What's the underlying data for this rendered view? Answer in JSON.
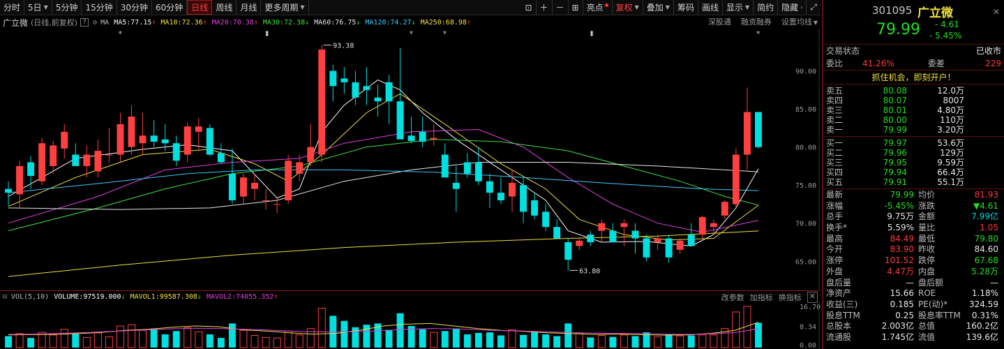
{
  "toolbar": {
    "periods": [
      "分时",
      "5日",
      "5分钟",
      "15分钟",
      "30分钟",
      "60分钟",
      "日线",
      "周线",
      "月线",
      "更多周期"
    ],
    "active_period": "日线",
    "tools": [
      "亮点",
      "复权",
      "叠加",
      "筹码",
      "画线",
      "显示",
      "简约",
      "隐藏"
    ],
    "icons": [
      "lock-icon",
      "plus-icon",
      "minus-icon",
      "grid-icon"
    ]
  },
  "stock": {
    "name": "广立微",
    "sub": "(日线,前复权)",
    "code": "301095",
    "price": "79.99",
    "change": "- 4.61",
    "change_pct": "- 5.45%"
  },
  "ma_legend": {
    "label": "MA",
    "items": [
      {
        "text": "MA5:77.15",
        "arrow": "↑",
        "color": "#ffffff"
      },
      {
        "text": "MA10:72.36",
        "arrow": "↑",
        "color": "#f0e040"
      },
      {
        "text": "MA20:70.38",
        "arrow": "↑",
        "color": "#e040e0"
      },
      {
        "text": "MA30:72.38",
        "arrow": "↓",
        "color": "#40e040"
      },
      {
        "text": "MA60:76.75",
        "arrow": "↓",
        "color": "#e8e8e8"
      },
      {
        "text": "MA120:74.27",
        "arrow": "↓",
        "color": "#40c8ff"
      },
      {
        "text": "MA250:68.98",
        "arrow": "↑",
        "color": "#f0e040"
      }
    ],
    "right": [
      "深股通",
      "融资融券",
      "设置均线"
    ]
  },
  "volume_legend": {
    "label": "VOL(5,10)",
    "items": [
      {
        "text": "VOLUME:97519.000",
        "arrow": "↓",
        "color": "#ffffff"
      },
      {
        "text": "MAVOL1:99587.308",
        "arrow": "↓",
        "color": "#f0e040"
      },
      {
        "text": "MAVOL2:74055.352",
        "arrow": "↑",
        "color": "#e040e0"
      }
    ],
    "right": [
      "改参数",
      "加指标",
      "换指标"
    ]
  },
  "chart_data": {
    "type": "candlestick",
    "ylim": [
      62,
      95
    ],
    "y_ticks": [
      65,
      70,
      75,
      80,
      85,
      90
    ],
    "y_tick_labels": [
      "65.00",
      "70.00",
      "75.00",
      "80.00",
      "85.00",
      "90.00"
    ],
    "max_label": "93.38",
    "min_label": "63.80",
    "candles": [
      [
        74.5,
        75.5,
        72.3,
        74.0
      ],
      [
        73.8,
        78.2,
        72.0,
        77.5
      ],
      [
        78.0,
        78.8,
        74.5,
        76.2
      ],
      [
        75.5,
        81.2,
        75.0,
        80.5
      ],
      [
        77.5,
        80.8,
        76.5,
        80.2
      ],
      [
        79.8,
        83.0,
        78.5,
        82.0
      ],
      [
        79.0,
        80.5,
        77.5,
        77.5
      ],
      [
        77.5,
        80.2,
        76.0,
        79.0
      ],
      [
        76.8,
        81.0,
        76.0,
        79.5
      ],
      [
        79.0,
        82.5,
        78.0,
        79.0
      ],
      [
        79.0,
        84.5,
        78.0,
        83.0
      ],
      [
        80.0,
        85.5,
        79.0,
        84.0
      ],
      [
        80.5,
        84.5,
        79.0,
        81.5
      ],
      [
        81.5,
        83.5,
        80.0,
        80.7
      ],
      [
        81.0,
        83.0,
        79.5,
        80.5
      ],
      [
        80.5,
        81.5,
        77.5,
        78.2
      ],
      [
        79.0,
        83.2,
        78.0,
        82.7
      ],
      [
        82.0,
        83.8,
        79.5,
        82.7
      ],
      [
        82.5,
        83.0,
        78.8,
        79.0
      ],
      [
        79.2,
        80.5,
        77.8,
        78.0
      ],
      [
        76.5,
        79.8,
        72.5,
        73.0
      ],
      [
        73.5,
        76.5,
        72.5,
        76.0
      ],
      [
        74.5,
        76.5,
        73.0,
        75.3
      ],
      [
        73.0,
        74.5,
        71.8,
        73.0
      ],
      [
        72.5,
        73.5,
        71.3,
        72.5
      ],
      [
        73.0,
        79.0,
        72.5,
        78.2
      ],
      [
        76.5,
        79.0,
        75.5,
        78.0
      ],
      [
        78.0,
        83.0,
        77.5,
        80.0
      ],
      [
        79.0,
        93.38,
        78.0,
        92.8
      ],
      [
        90.0,
        90.8,
        86.0,
        88.0
      ],
      [
        89.0,
        90.5,
        87.0,
        88.5
      ],
      [
        88.5,
        90.0,
        85.5,
        86.5
      ],
      [
        88.0,
        90.5,
        85.5,
        87.5
      ],
      [
        86.5,
        88.2,
        84.0,
        86.0
      ],
      [
        88.5,
        89.5,
        83.0,
        86.0
      ],
      [
        86.0,
        93.0,
        85.0,
        81.0
      ],
      [
        81.5,
        84.0,
        80.5,
        80.8
      ],
      [
        82.0,
        84.0,
        80.0,
        80.7
      ],
      [
        81.0,
        83.0,
        80.2,
        81.2
      ],
      [
        79.0,
        80.5,
        76.0,
        76.0
      ],
      [
        75.3,
        77.5,
        71.5,
        74.5
      ],
      [
        78.0,
        79.2,
        76.0,
        76.5
      ],
      [
        78.0,
        80.0,
        75.0,
        75.5
      ],
      [
        75.5,
        76.5,
        72.0,
        74.0
      ],
      [
        74.0,
        76.0,
        72.5,
        73.0
      ],
      [
        73.5,
        77.0,
        71.5,
        75.3
      ],
      [
        75.0,
        76.0,
        70.0,
        71.5
      ],
      [
        73.0,
        74.0,
        70.5,
        71.0
      ],
      [
        71.5,
        72.5,
        69.0,
        69.5
      ],
      [
        69.5,
        70.5,
        68.0,
        68.0
      ],
      [
        67.5,
        68.0,
        63.8,
        65.2
      ],
      [
        67.0,
        68.0,
        66.5,
        67.7
      ],
      [
        68.5,
        69.0,
        67.0,
        67.5
      ],
      [
        69.0,
        70.5,
        67.5,
        70.0
      ],
      [
        69.0,
        70.0,
        67.5,
        67.5
      ],
      [
        69.5,
        70.5,
        67.0,
        70.0
      ],
      [
        69.0,
        70.0,
        66.0,
        68.0
      ],
      [
        68.0,
        68.5,
        65.0,
        65.5
      ],
      [
        67.5,
        68.5,
        66.5,
        68.0
      ],
      [
        68.0,
        68.5,
        64.8,
        65.5
      ],
      [
        66.5,
        68.0,
        66.0,
        67.7
      ],
      [
        68.5,
        70.0,
        67.0,
        67.0
      ],
      [
        68.5,
        71.0,
        68.0,
        70.8
      ],
      [
        69.5,
        70.5,
        68.5,
        70.0
      ],
      [
        71.0,
        73.0,
        70.5,
        72.8
      ],
      [
        72.5,
        79.8,
        72.0,
        79.0
      ],
      [
        79.0,
        87.8,
        77.0,
        84.6
      ],
      [
        84.6,
        84.5,
        79.8,
        79.99
      ]
    ],
    "ma_series": [
      {
        "name": "MA5",
        "color": "#ffffff",
        "values": [
          [
            0,
            73.5
          ],
          [
            6,
            78.5
          ],
          [
            12,
            79.7
          ],
          [
            16,
            80.3
          ],
          [
            20,
            79.5
          ],
          [
            24,
            73.3
          ],
          [
            26,
            74.5
          ],
          [
            28,
            82.0
          ],
          [
            30,
            85.5
          ],
          [
            33,
            88.8
          ],
          [
            35,
            87.5
          ],
          [
            37,
            84.5
          ],
          [
            40,
            81.0
          ],
          [
            44,
            77.0
          ],
          [
            48,
            73.0
          ],
          [
            50,
            69.0
          ],
          [
            53,
            67.5
          ],
          [
            57,
            67.6
          ],
          [
            61,
            67.0
          ],
          [
            63,
            68.5
          ],
          [
            65,
            72.0
          ],
          [
            67,
            77.15
          ]
        ]
      },
      {
        "name": "MA10",
        "color": "#f0e040",
        "values": [
          [
            0,
            72.2
          ],
          [
            6,
            76.0
          ],
          [
            12,
            79.0
          ],
          [
            18,
            79.7
          ],
          [
            22,
            77.8
          ],
          [
            25,
            75.5
          ],
          [
            28,
            79.0
          ],
          [
            32,
            84.5
          ],
          [
            35,
            87.0
          ],
          [
            39,
            83.0
          ],
          [
            44,
            77.8
          ],
          [
            48,
            74.5
          ],
          [
            51,
            70.5
          ],
          [
            55,
            68.5
          ],
          [
            59,
            67.8
          ],
          [
            63,
            68.0
          ],
          [
            67,
            72.36
          ]
        ]
      },
      {
        "name": "MA20",
        "color": "#e040e0",
        "values": [
          [
            0,
            70.0
          ],
          [
            8,
            73.5
          ],
          [
            14,
            77.0
          ],
          [
            20,
            78.0
          ],
          [
            26,
            78.5
          ],
          [
            30,
            80.5
          ],
          [
            36,
            82.0
          ],
          [
            42,
            82.3
          ],
          [
            46,
            80.0
          ],
          [
            50,
            76.0
          ],
          [
            54,
            72.5
          ],
          [
            58,
            70.0
          ],
          [
            62,
            68.8
          ],
          [
            67,
            70.38
          ]
        ]
      },
      {
        "name": "MA30",
        "color": "#40e040",
        "values": [
          [
            0,
            69.0
          ],
          [
            8,
            72.0
          ],
          [
            14,
            74.5
          ],
          [
            20,
            76.5
          ],
          [
            26,
            77.5
          ],
          [
            32,
            80.0
          ],
          [
            38,
            81.0
          ],
          [
            44,
            80.7
          ],
          [
            50,
            79.5
          ],
          [
            55,
            77.5
          ],
          [
            60,
            75.5
          ],
          [
            64,
            73.5
          ],
          [
            67,
            72.38
          ]
        ]
      },
      {
        "name": "MA60",
        "color": "#e8e8e8",
        "values": [
          [
            0,
            72.0
          ],
          [
            10,
            71.8
          ],
          [
            18,
            72.0
          ],
          [
            24,
            73.0
          ],
          [
            30,
            75.5
          ],
          [
            36,
            77.0
          ],
          [
            42,
            78.0
          ],
          [
            50,
            78.0
          ],
          [
            58,
            77.5
          ],
          [
            64,
            77.0
          ],
          [
            67,
            76.75
          ]
        ]
      },
      {
        "name": "MA120",
        "color": "#40c8ff",
        "values": [
          [
            0,
            74.0
          ],
          [
            8,
            75.2
          ],
          [
            16,
            76.5
          ],
          [
            22,
            77.0
          ],
          [
            30,
            77.0
          ],
          [
            38,
            76.7
          ],
          [
            46,
            76.0
          ],
          [
            54,
            75.2
          ],
          [
            62,
            74.5
          ],
          [
            67,
            74.27
          ]
        ]
      },
      {
        "name": "MA250",
        "color": "#f0e040",
        "values": [
          [
            0,
            63.0
          ],
          [
            10,
            64.5
          ],
          [
            20,
            65.8
          ],
          [
            30,
            66.8
          ],
          [
            40,
            67.5
          ],
          [
            50,
            68.0
          ],
          [
            58,
            68.3
          ],
          [
            67,
            68.98
          ]
        ]
      }
    ],
    "volume": {
      "ylim": [
        0,
        17
      ],
      "y_tick_labels": [
        "16.70",
        "8.34",
        "0.00"
      ],
      "y_ticks": [
        16.7,
        8.34,
        0
      ],
      "values": [
        4.5,
        5.5,
        3.8,
        6.0,
        5.0,
        7.2,
        5.5,
        4.0,
        5.8,
        4.2,
        8.5,
        9.0,
        6.8,
        7.5,
        5.2,
        6.5,
        7.8,
        6.2,
        5.2,
        3.8,
        9.5,
        6.8,
        4.8,
        4.0,
        3.8,
        6.5,
        5.0,
        7.5,
        15.5,
        12.5,
        10.5,
        8.0,
        9.0,
        9.5,
        7.0,
        13.5,
        8.5,
        7.2,
        6.0,
        6.5,
        7.5,
        5.2,
        5.8,
        6.0,
        4.8,
        7.0,
        5.0,
        6.0,
        5.2,
        4.5,
        9.5,
        5.5,
        4.0,
        4.8,
        4.2,
        5.0,
        4.5,
        6.0,
        4.2,
        5.2,
        4.6,
        4.8,
        5.0,
        5.0,
        7.5,
        14.0,
        16.2,
        9.75
      ],
      "ma1": [
        5.0,
        5.1,
        5.2,
        5.5,
        6.0,
        6.8,
        7.2,
        8.0,
        8.5,
        8.2,
        7.0,
        6.5,
        5.8,
        5.3,
        5.6,
        6.8,
        8.5,
        9.2,
        9.5,
        8.5,
        7.5,
        6.8,
        6.4,
        5.8,
        5.5,
        5.2,
        5.3,
        5.1,
        4.9,
        5.0,
        5.6,
        6.8,
        9.96
      ],
      "ma2": [
        5.2,
        5.3,
        5.5,
        5.8,
        6.2,
        6.6,
        7.0,
        7.4,
        7.6,
        7.5,
        7.2,
        6.9,
        6.5,
        6.2,
        6.1,
        6.3,
        6.7,
        7.2,
        7.5,
        7.4,
        7.0,
        6.7,
        6.5,
        6.2,
        5.9,
        5.7,
        5.6,
        5.5,
        5.3,
        5.2,
        5.4,
        5.9,
        7.41
      ]
    }
  },
  "panel": {
    "trade_status_label": "交易状态",
    "trade_status": "已收市",
    "weibi_label": "委比",
    "weibi": "41.26%",
    "weicha_label": "委差",
    "weicha": "229",
    "promo": "抓住机会，即刻开户！",
    "asks": [
      {
        "label": "卖五",
        "price": "80.08",
        "vol": "12.0万"
      },
      {
        "label": "卖四",
        "price": "80.07",
        "vol": "8007"
      },
      {
        "label": "卖三",
        "price": "80.01",
        "vol": "4.80万"
      },
      {
        "label": "卖二",
        "price": "80.00",
        "vol": "110万"
      },
      {
        "label": "卖一",
        "price": "79.99",
        "vol": "3.20万"
      }
    ],
    "bids": [
      {
        "label": "买一",
        "price": "79.97",
        "vol": "53.6万"
      },
      {
        "label": "买二",
        "price": "79.96",
        "vol": "129万"
      },
      {
        "label": "买三",
        "price": "79.95",
        "vol": "9.59万"
      },
      {
        "label": "买四",
        "price": "79.94",
        "vol": "66.4万"
      },
      {
        "label": "买五",
        "price": "79.91",
        "vol": "55.1万"
      }
    ],
    "stats": [
      {
        "k1": "最新",
        "v1": "79.99",
        "c1": "green",
        "k2": "均价",
        "v2": "81.93",
        "c2": "red"
      },
      {
        "k1": "涨幅",
        "v1": "-5.45%",
        "c1": "green",
        "k2": "涨跌",
        "v2": "▼4.61",
        "c2": "green"
      },
      {
        "k1": "总手",
        "v1": "9.75万",
        "c1": "white",
        "k2": "金额",
        "v2": "7.99亿",
        "c2": "cyan"
      },
      {
        "k1": "换手*",
        "v1": "5.59%",
        "c1": "white",
        "k2": "量比",
        "v2": "1.05",
        "c2": "red"
      },
      {
        "k1": "最高",
        "v1": "84.49",
        "c1": "red",
        "k2": "最低",
        "v2": "79.80",
        "c2": "green"
      },
      {
        "k1": "今开",
        "v1": "83.90",
        "c1": "red",
        "k2": "昨收",
        "v2": "84.60",
        "c2": "white"
      },
      {
        "k1": "涨停",
        "v1": "101.52",
        "c1": "red",
        "k2": "跌停",
        "v2": "67.68",
        "c2": "green"
      },
      {
        "k1": "外盘",
        "v1": "4.47万",
        "c1": "red",
        "k2": "内盘",
        "v2": "5.28万",
        "c2": "green"
      },
      {
        "k1": "盘后量",
        "v1": "—",
        "c1": "white",
        "k2": "盘后额",
        "v2": "—",
        "c2": "white"
      },
      {
        "k1": "净资产",
        "v1": "15.66",
        "c1": "white",
        "k2": "ROE",
        "v2": "1.18%",
        "c2": "white"
      },
      {
        "k1": "收益(三)",
        "v1": "0.185",
        "c1": "white",
        "k2": "PE(动)*",
        "v2": "324.59",
        "c2": "white"
      },
      {
        "k1": "股息TTM",
        "v1": "0.25",
        "c1": "white",
        "k2": "股息率TTM",
        "v2": "0.31%",
        "c2": "white"
      },
      {
        "k1": "总股本",
        "v1": "2.003亿",
        "c1": "white",
        "k2": "总值",
        "v2": "160.2亿",
        "c2": "white"
      },
      {
        "k1": "流通股",
        "v1": "1.745亿",
        "c1": "white",
        "k2": "流值",
        "v2": "139.6亿",
        "c2": "white"
      }
    ]
  }
}
